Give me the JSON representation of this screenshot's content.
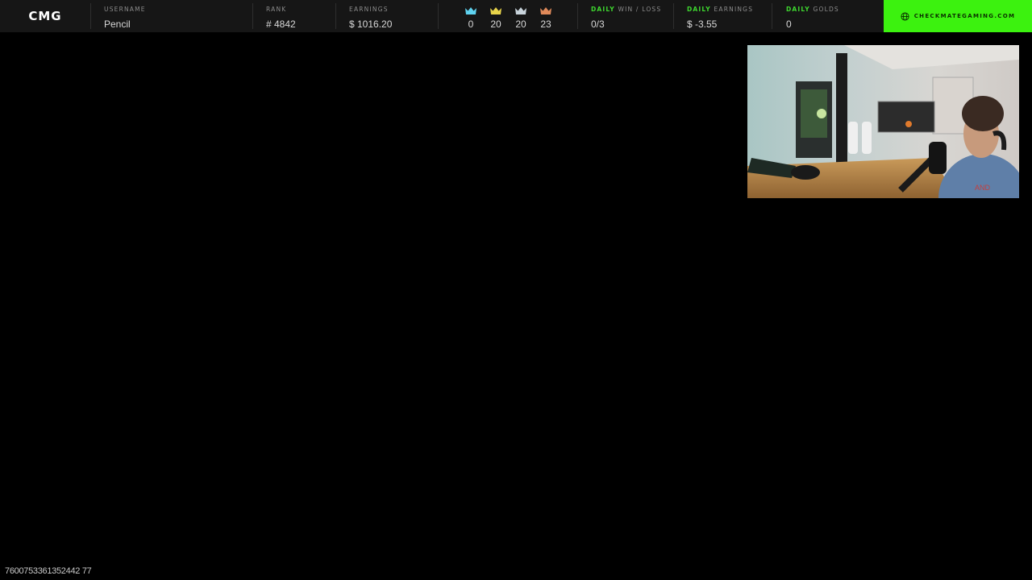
{
  "logo": {
    "text": "CMG"
  },
  "stats": {
    "username_label": "USERNAME",
    "username": "Pencil",
    "rank_label": "RANK",
    "rank": "# 4842",
    "earnings_label": "EARNINGS",
    "earnings": "$ 1016.20"
  },
  "crowns": [
    {
      "icon": "diamond-crown-icon",
      "color": "#5fd3f0",
      "count": "0"
    },
    {
      "icon": "gold-crown-icon",
      "color": "#e8d44a",
      "count": "20"
    },
    {
      "icon": "silver-crown-icon",
      "color": "#c9d4dc",
      "count": "20"
    },
    {
      "icon": "bronze-crown-icon",
      "color": "#e08a5a",
      "count": "23"
    }
  ],
  "daily": {
    "prefix": "DAILY",
    "winloss_label": "WIN / LOSS",
    "winloss": "0/3",
    "earnings_label": "EARNINGS",
    "earnings": "$ -3.55",
    "golds_label": "GOLDS",
    "golds": "0"
  },
  "site": {
    "icon": "globe-icon",
    "label": "CHECKMATEGAMING.COM",
    "bg_color": "#3cf20f"
  },
  "webcam": {
    "icon": "webcam-feed"
  },
  "footer": {
    "id_text": "7600753361352442 77"
  },
  "colors": {
    "topbar_bg": "#161616",
    "accent_green": "#3ed82f"
  }
}
